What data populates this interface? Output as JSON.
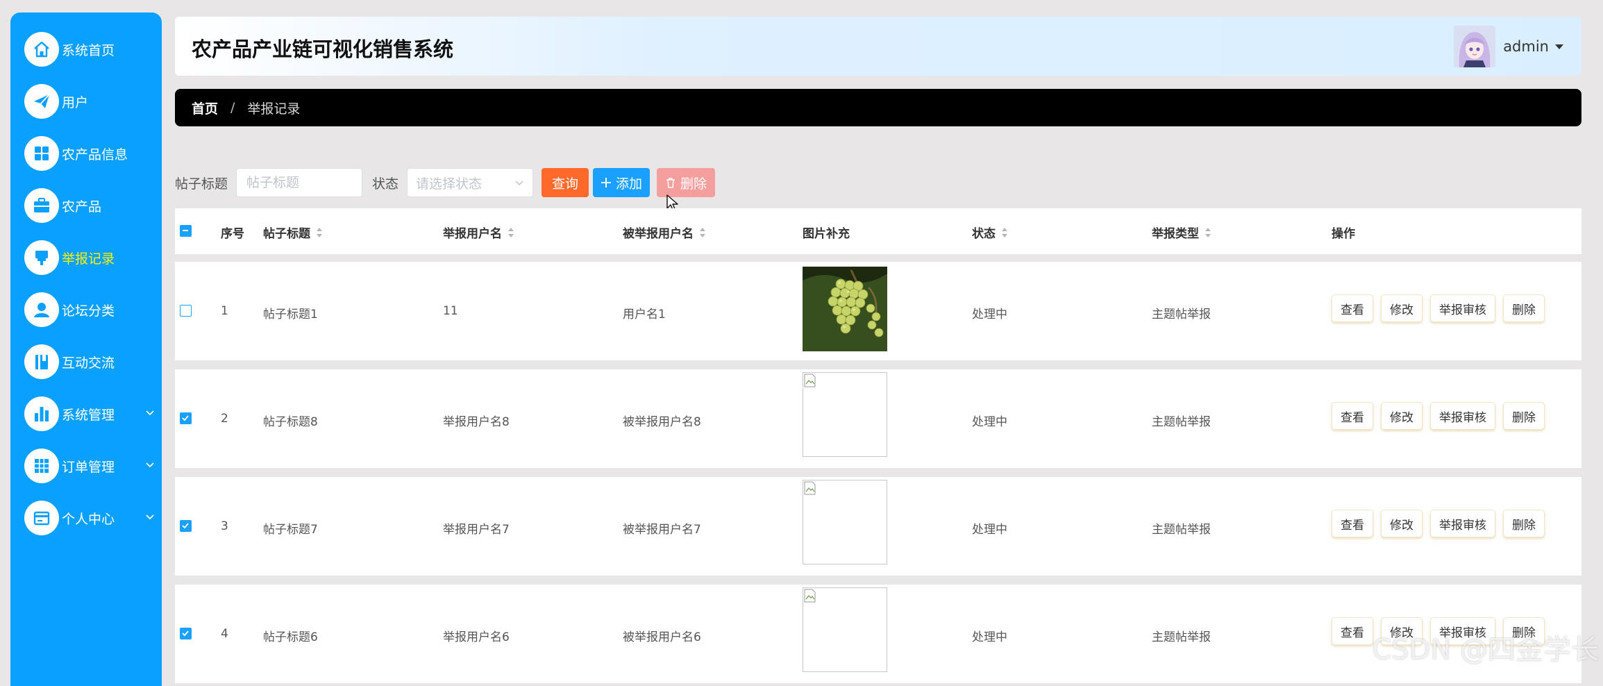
{
  "sidebar": {
    "items": [
      {
        "label": "系统首页",
        "icon": "home-icon"
      },
      {
        "label": "用户",
        "icon": "paper-plane-icon"
      },
      {
        "label": "农产品信息",
        "icon": "grid-icon"
      },
      {
        "label": "农产品",
        "icon": "briefcase-icon"
      },
      {
        "label": "举报记录",
        "icon": "flag-icon",
        "active": true
      },
      {
        "label": "论坛分类",
        "icon": "user-icon"
      },
      {
        "label": "互动交流",
        "icon": "book-icon"
      },
      {
        "label": "系统管理",
        "icon": "bar-chart-icon",
        "expandable": true
      },
      {
        "label": "订单管理",
        "icon": "table-icon",
        "expandable": true
      },
      {
        "label": "个人中心",
        "icon": "card-icon",
        "expandable": true
      }
    ]
  },
  "header": {
    "title": "农产品产业链可视化销售系统",
    "username": "admin"
  },
  "breadcrumb": {
    "home": "首页",
    "separator": "/",
    "current": "举报记录"
  },
  "search": {
    "title_label": "帖子标题",
    "title_placeholder": "帖子标题",
    "status_label": "状态",
    "status_placeholder": "请选择状态",
    "query_label": "查询",
    "add_label": "添加",
    "delete_label": "删除"
  },
  "table": {
    "columns": [
      "序号",
      "帖子标题",
      "举报用户名",
      "被举报用户名",
      "图片补充",
      "状态",
      "举报类型",
      "操作"
    ],
    "rows": [
      {
        "index": "1",
        "title": "帖子标题1",
        "reporter": "11",
        "reported": "用户名1",
        "image": "grapes",
        "status": "处理中",
        "type": "主题帖举报",
        "checked": false
      },
      {
        "index": "2",
        "title": "帖子标题8",
        "reporter": "举报用户名8",
        "reported": "被举报用户名8",
        "image": "broken",
        "status": "处理中",
        "type": "主题帖举报",
        "checked": true
      },
      {
        "index": "3",
        "title": "帖子标题7",
        "reporter": "举报用户名7",
        "reported": "被举报用户名7",
        "image": "broken",
        "status": "处理中",
        "type": "主题帖举报",
        "checked": true
      },
      {
        "index": "4",
        "title": "帖子标题6",
        "reporter": "举报用户名6",
        "reported": "被举报用户名6",
        "image": "broken",
        "status": "处理中",
        "type": "主题帖举报",
        "checked": true
      }
    ],
    "actions": {
      "view": "查看",
      "edit": "修改",
      "audit": "举报审核",
      "delete": "删除"
    }
  },
  "watermark": "CSDN @四金学长",
  "colors": {
    "sidebar_bg": "#0aa0ff",
    "active_label": "#fff200",
    "query_button": "#ff6a2b",
    "add_button": "#1aa1ff",
    "delete_button": "#f59e9e",
    "breadcrumb_bg": "#000000"
  }
}
